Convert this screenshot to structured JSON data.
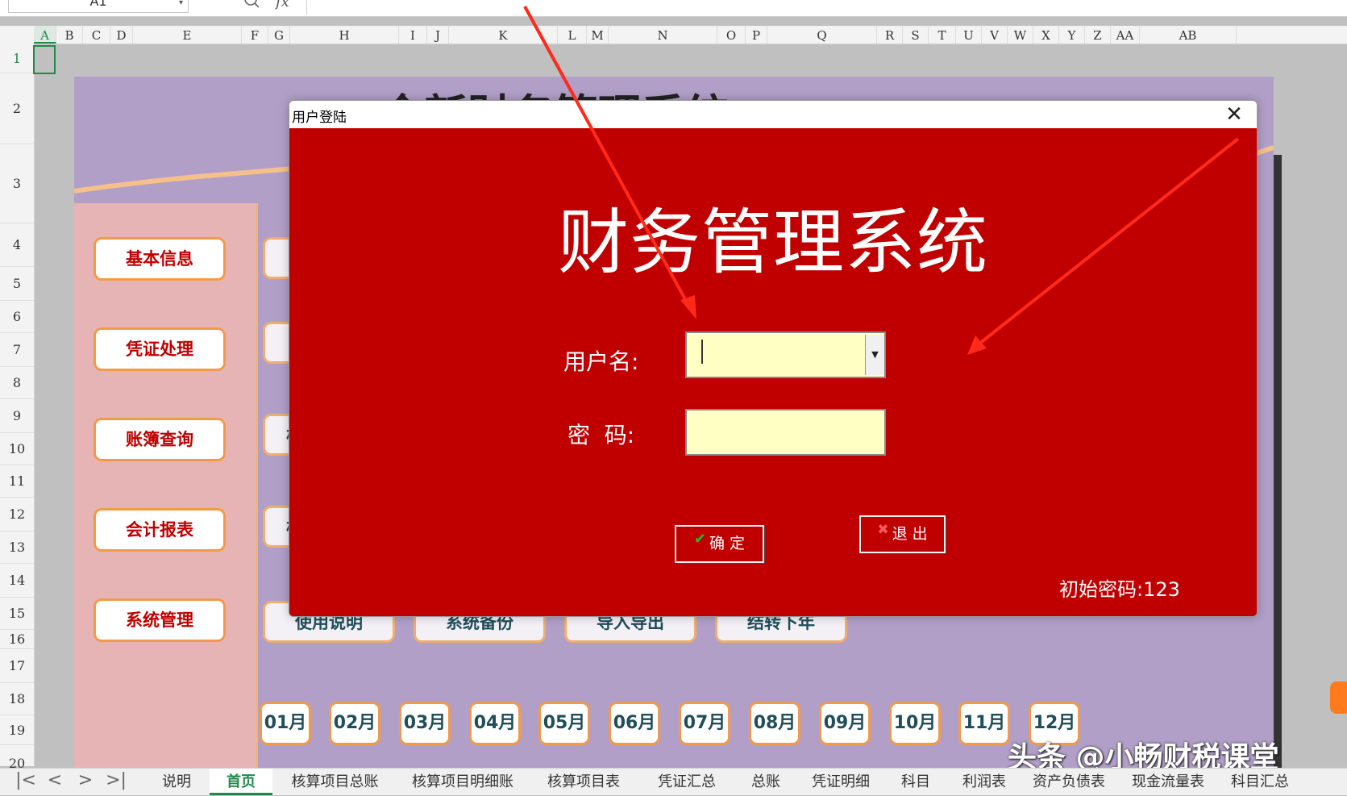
{
  "formula_bar": {
    "name_box": "A1",
    "name_box_arrow_icon": "chevron-down-icon",
    "zoom_icon": "search-icon",
    "fx_label": "fx"
  },
  "columns": [
    "A",
    "B",
    "C",
    "D",
    "E",
    "F",
    "G",
    "H",
    "I",
    "J",
    "K",
    "L",
    "M",
    "N",
    "O",
    "P",
    "Q",
    "R",
    "S",
    "T",
    "U",
    "V",
    "W",
    "X",
    "Y",
    "Z",
    "AA",
    "AB"
  ],
  "rows": [
    "1",
    "2",
    "3",
    "4",
    "5",
    "6",
    "7",
    "8",
    "9",
    "10",
    "11",
    "12",
    "13",
    "14",
    "15",
    "16",
    "17",
    "18",
    "19",
    "20"
  ],
  "dashboard": {
    "title_partial": "全新财务管理系统",
    "side_buttons": [
      "基本信息",
      "凭证处理",
      "账簿查询",
      "会计报表",
      "系统管理"
    ],
    "tool_buttons": [
      "使用说明",
      "系统备份",
      "导入导出",
      "结转下年"
    ],
    "row_partial_labels": [
      "",
      "",
      "核",
      "核"
    ],
    "months": [
      "01月",
      "02月",
      "03月",
      "04月",
      "05月",
      "06月",
      "07月",
      "08月",
      "09月",
      "10月",
      "11月",
      "12月"
    ]
  },
  "dialog": {
    "title": "用户登陆",
    "close_glyph": "✕",
    "heading": "财务管理系统",
    "username_label": "用户名:",
    "password_label": "密  码:",
    "username_value": "",
    "password_value": "",
    "dropdown_glyph": "▼",
    "ok_label": "确 定",
    "ok_icon_glyph": "✔",
    "exit_label": "退 出",
    "exit_icon_glyph": "✖",
    "initial_password_note": "初始密码:123",
    "colors": {
      "background": "#c00000",
      "input_bg": "#ffffc4"
    }
  },
  "sheet_nav": {
    "first": "|<",
    "prev": "<",
    "next": ">",
    "last": ">|"
  },
  "sheet_tabs": [
    {
      "label": "说明",
      "active": false
    },
    {
      "label": "首页",
      "active": true
    },
    {
      "label": "核算项目总账",
      "active": false
    },
    {
      "label": "核算项目明细账",
      "active": false
    },
    {
      "label": "核算项目表",
      "active": false
    },
    {
      "label": "凭证汇总",
      "active": false
    },
    {
      "label": "总账",
      "active": false
    },
    {
      "label": "凭证明细",
      "active": false
    },
    {
      "label": "科目",
      "active": false
    },
    {
      "label": "利润表",
      "active": false
    },
    {
      "label": "资产负债表",
      "active": false
    },
    {
      "label": "现金流量表",
      "active": false
    },
    {
      "label": "科目汇总",
      "active": false
    }
  ],
  "watermark": "头条 @小畅财税课堂",
  "colors": {
    "accent_green": "#1e8a4c",
    "dashboard_bg": "#b19fc8",
    "sidebar_bg": "#e7b4b6",
    "button_border": "#f39a4a",
    "arrow": "#ff2a1a"
  }
}
